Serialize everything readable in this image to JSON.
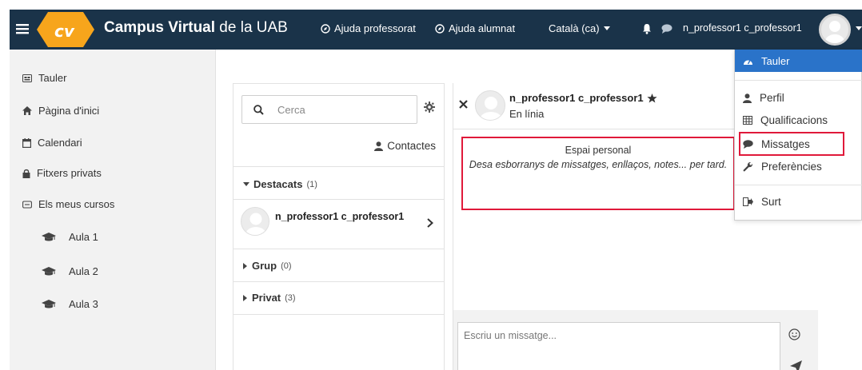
{
  "navbar": {
    "brand_bold": "Campus Virtual",
    "brand_rest": " de la UAB",
    "links": [
      {
        "label": "Ajuda professorat"
      },
      {
        "label": "Ajuda alumnat"
      }
    ],
    "language": "Català (ca)",
    "user_name": "n_professor1 c_professor1"
  },
  "drawer": {
    "items": [
      {
        "label": "Tauler",
        "icon": "dashboard-icon"
      },
      {
        "label": "Pàgina d'inici",
        "icon": "home-icon"
      },
      {
        "label": "Calendari",
        "icon": "calendar-icon"
      },
      {
        "label": "Fitxers privats",
        "icon": "file-icon"
      },
      {
        "label": "Els meus cursos",
        "icon": "courses-icon"
      }
    ],
    "courses": [
      {
        "label": "Aula 1",
        "icon": "graduation-cap-icon"
      },
      {
        "label": "Aula 2",
        "icon": "graduation-cap-icon"
      },
      {
        "label": "Aula 3",
        "icon": "graduation-cap-icon"
      }
    ]
  },
  "messaging": {
    "search_placeholder": "Cerca",
    "contacts_label": "Contactes",
    "sections": {
      "starred": {
        "label": "Destacats",
        "count": "(1)"
      },
      "group": {
        "label": "Grup",
        "count": "(0)"
      },
      "private": {
        "label": "Privat",
        "count": "(3)"
      }
    },
    "conversation_name": "n_professor1 c_professor1",
    "header": {
      "name": "n_professor1 c_professor1",
      "status": "En línia"
    },
    "personal_space": {
      "title": "Espai personal",
      "description": "Desa esborranys de missatges, enllaços, notes... per tard."
    },
    "compose_placeholder": "Escriu un missatge..."
  },
  "user_menu": {
    "items": [
      {
        "label": "Tauler",
        "icon": "dashboard-icon",
        "active": true
      },
      {
        "label": "Perfil",
        "icon": "user-icon"
      },
      {
        "label": "Qualificacions",
        "icon": "table-icon"
      },
      {
        "label": "Missatges",
        "icon": "comment-icon"
      },
      {
        "label": "Preferències",
        "icon": "wrench-icon"
      },
      {
        "label": "Surt",
        "icon": "sign-out-icon"
      }
    ]
  },
  "colors": {
    "navbar": "#1a3349",
    "accent": "#2a73c9",
    "highlight": "#e0193a",
    "logo": "#f7a51c"
  }
}
